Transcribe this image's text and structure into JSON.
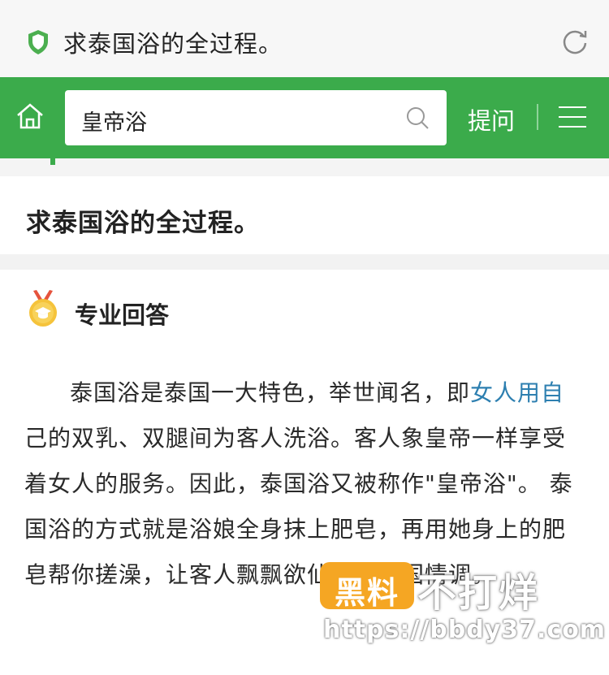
{
  "topbar": {
    "title": "求泰国浴的全过程。"
  },
  "navbar": {
    "search_value": "皇帝浴",
    "ask_label": "提问"
  },
  "question": {
    "title": "求泰国浴的全过程。"
  },
  "answer": {
    "label": "专业回答",
    "p1_a": "泰国浴是泰国一大特色，举世闻名，即",
    "p1_link": "女人用自",
    "p1_b": "己的双乳、双腿间为客人洗浴。客人象皇帝一样享受着女人的服务。因此，泰国浴又被称作\"皇帝浴\"。 泰国浴的方式就是浴娘全身抹上肥皂，再用她身上的肥皂帮你搓澡，让客人飘飘欲仙享受异国情调。"
  },
  "watermark": {
    "box_text": "黑料",
    "brand": "不打烊",
    "url": "https://bbdy37.com"
  },
  "colors": {
    "brand_green": "#3bab4b",
    "link_blue": "#2d7fb0",
    "watermark_orange": "#f5a623"
  }
}
